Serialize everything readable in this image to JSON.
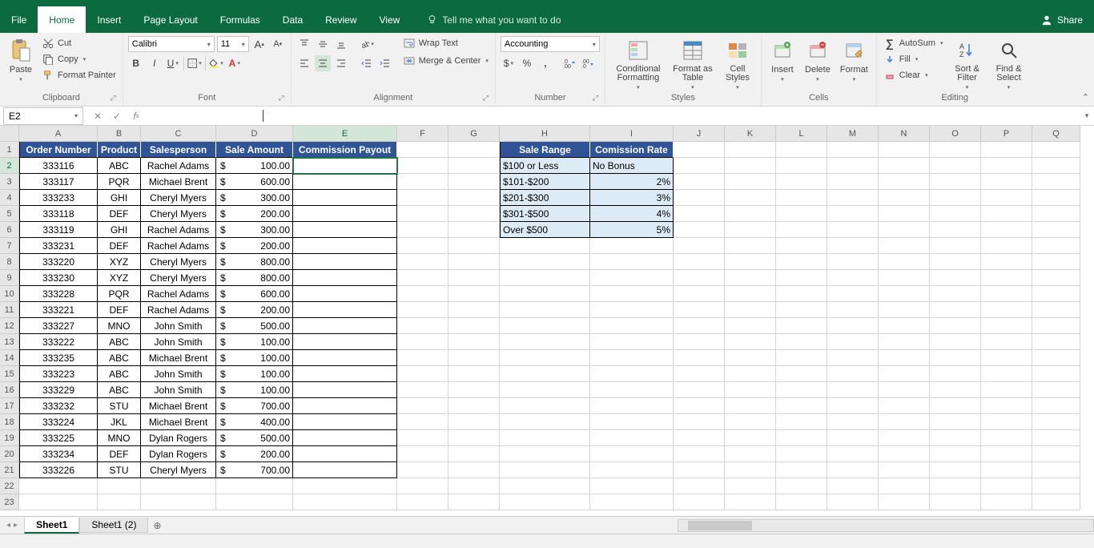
{
  "tabs": [
    "File",
    "Home",
    "Insert",
    "Page Layout",
    "Formulas",
    "Data",
    "Review",
    "View"
  ],
  "tellme": "Tell me what you want to do",
  "share": "Share",
  "clipboard": {
    "label": "Clipboard",
    "paste": "Paste",
    "cut": "Cut",
    "copy": "Copy",
    "fp": "Format Painter"
  },
  "font": {
    "label": "Font",
    "name": "Calibri",
    "size": "11"
  },
  "alignment": {
    "label": "Alignment",
    "wrap": "Wrap Text",
    "merge": "Merge & Center"
  },
  "number": {
    "label": "Number",
    "format": "Accounting",
    "cur": "$",
    "pct": "%",
    "comma": ","
  },
  "styles": {
    "label": "Styles",
    "cf": "Conditional Formatting",
    "fat": "Format as Table",
    "cs": "Cell Styles"
  },
  "cells": {
    "label": "Cells",
    "ins": "Insert",
    "del": "Delete",
    "fmt": "Format"
  },
  "editing": {
    "label": "Editing",
    "asum": "AutoSum",
    "fill": "Fill",
    "clear": "Clear",
    "sort": "Sort & Filter",
    "find": "Find & Select"
  },
  "namebox": "E2",
  "colwidths": {
    "A": 98,
    "B": 54,
    "C": 94,
    "D": 96,
    "E": 130,
    "F": 64,
    "G": 64,
    "H": 113,
    "I": 104,
    "J": 64,
    "K": 64,
    "L": 64,
    "M": 64,
    "N": 64,
    "O": 64,
    "P": 64,
    "Q": 60
  },
  "cols": [
    "A",
    "B",
    "C",
    "D",
    "E",
    "F",
    "G",
    "H",
    "I",
    "J",
    "K",
    "L",
    "M",
    "N",
    "O",
    "P",
    "Q"
  ],
  "rows": 23,
  "activeCell": {
    "row": 2,
    "col": "E"
  },
  "headers1": [
    "Order Number",
    "Product",
    "Salesperson",
    "Sale Amount",
    "Commission Payout"
  ],
  "headers2": [
    "Sale Range",
    "Comission Rate"
  ],
  "data": [
    [
      "333116",
      "ABC",
      "Rachel Adams",
      "100.00"
    ],
    [
      "333117",
      "PQR",
      "Michael Brent",
      "600.00"
    ],
    [
      "333233",
      "GHI",
      "Cheryl Myers",
      "300.00"
    ],
    [
      "333118",
      "DEF",
      "Cheryl Myers",
      "200.00"
    ],
    [
      "333119",
      "GHI",
      "Rachel Adams",
      "300.00"
    ],
    [
      "333231",
      "DEF",
      "Rachel Adams",
      "200.00"
    ],
    [
      "333220",
      "XYZ",
      "Cheryl Myers",
      "800.00"
    ],
    [
      "333230",
      "XYZ",
      "Cheryl Myers",
      "800.00"
    ],
    [
      "333228",
      "PQR",
      "Rachel Adams",
      "600.00"
    ],
    [
      "333221",
      "DEF",
      "Rachel Adams",
      "200.00"
    ],
    [
      "333227",
      "MNO",
      "John Smith",
      "500.00"
    ],
    [
      "333222",
      "ABC",
      "John Smith",
      "100.00"
    ],
    [
      "333235",
      "ABC",
      "Michael Brent",
      "100.00"
    ],
    [
      "333223",
      "ABC",
      "John Smith",
      "100.00"
    ],
    [
      "333229",
      "ABC",
      "John Smith",
      "100.00"
    ],
    [
      "333232",
      "STU",
      "Michael Brent",
      "700.00"
    ],
    [
      "333224",
      "JKL",
      "Michael Brent",
      "400.00"
    ],
    [
      "333225",
      "MNO",
      "Dylan Rogers",
      "500.00"
    ],
    [
      "333234",
      "DEF",
      "Dylan Rogers",
      "200.00"
    ],
    [
      "333226",
      "STU",
      "Cheryl Myers",
      "700.00"
    ]
  ],
  "lookup": [
    [
      "$100 or Less",
      "No Bonus"
    ],
    [
      "$101-$200",
      "2%"
    ],
    [
      "$201-$300",
      "3%"
    ],
    [
      "$301-$500",
      "4%"
    ],
    [
      "Over $500",
      "5%"
    ]
  ],
  "currency": "$",
  "sheets": [
    "Sheet1",
    "Sheet1 (2)"
  ]
}
